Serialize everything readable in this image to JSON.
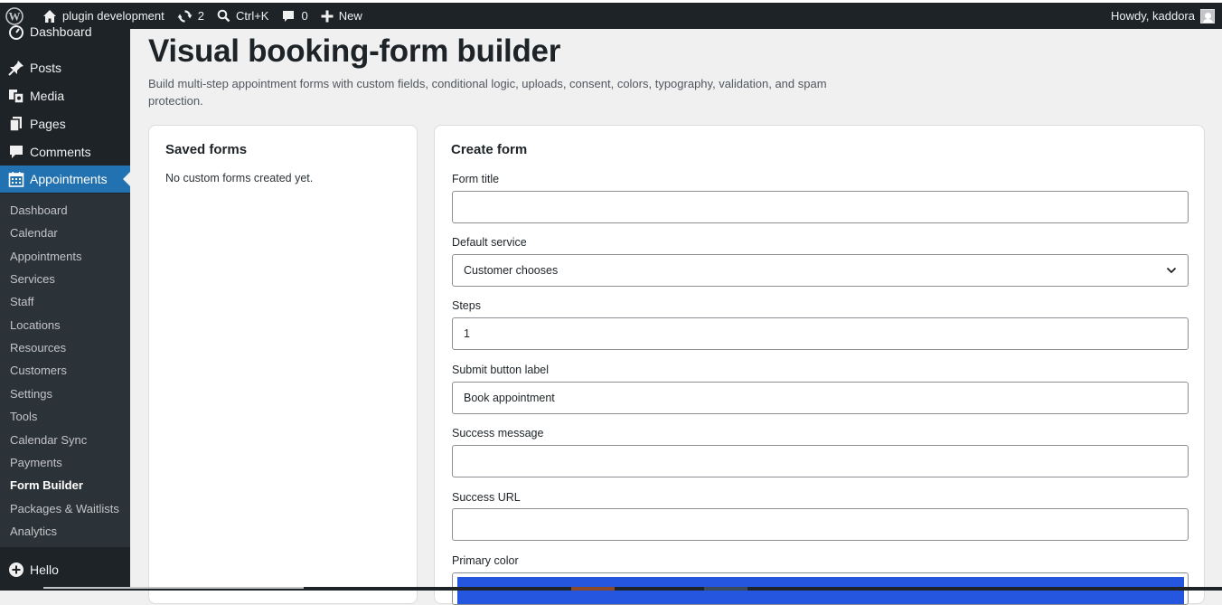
{
  "adminbar": {
    "site_name": "plugin development",
    "updates_count": "2",
    "search_shortcut": "Ctrl+K",
    "comments_count": "0",
    "new_label": "New",
    "greeting": "Howdy, kaddora"
  },
  "sidebar": {
    "top_items": [
      {
        "label": "Dashboard",
        "icon": "dashboard-icon"
      },
      {
        "label": "Posts",
        "icon": "pin-icon"
      },
      {
        "label": "Media",
        "icon": "media-icon"
      },
      {
        "label": "Pages",
        "icon": "pages-icon"
      },
      {
        "label": "Comments",
        "icon": "comment-icon"
      },
      {
        "label": "Appointments",
        "icon": "calendar-icon"
      }
    ],
    "submenu": [
      "Dashboard",
      "Calendar",
      "Appointments",
      "Services",
      "Staff",
      "Locations",
      "Resources",
      "Customers",
      "Settings",
      "Tools",
      "Calendar Sync",
      "Payments",
      "Form Builder",
      "Packages & Waitlists",
      "Analytics"
    ],
    "active_submenu": "Form Builder",
    "bottom_item": {
      "label": "Hello",
      "icon": "plus-circle-icon"
    }
  },
  "main": {
    "title": "Visual booking-form builder",
    "description": "Build multi-step appointment forms with custom fields, conditional logic, uploads, consent, colors, typography, validation, and spam protection."
  },
  "saved_forms": {
    "heading": "Saved forms",
    "empty_text": "No custom forms created yet."
  },
  "create_form": {
    "heading": "Create form",
    "form_title_label": "Form title",
    "form_title_value": "",
    "default_service_label": "Default service",
    "default_service_value": "Customer chooses",
    "steps_label": "Steps",
    "steps_value": "1",
    "submit_label_label": "Submit button label",
    "submit_label_value": "Book appointment",
    "success_message_label": "Success message",
    "success_message_value": "",
    "success_url_label": "Success URL",
    "success_url_value": "",
    "primary_color_label": "Primary color",
    "primary_color_value": "#2456e0"
  }
}
